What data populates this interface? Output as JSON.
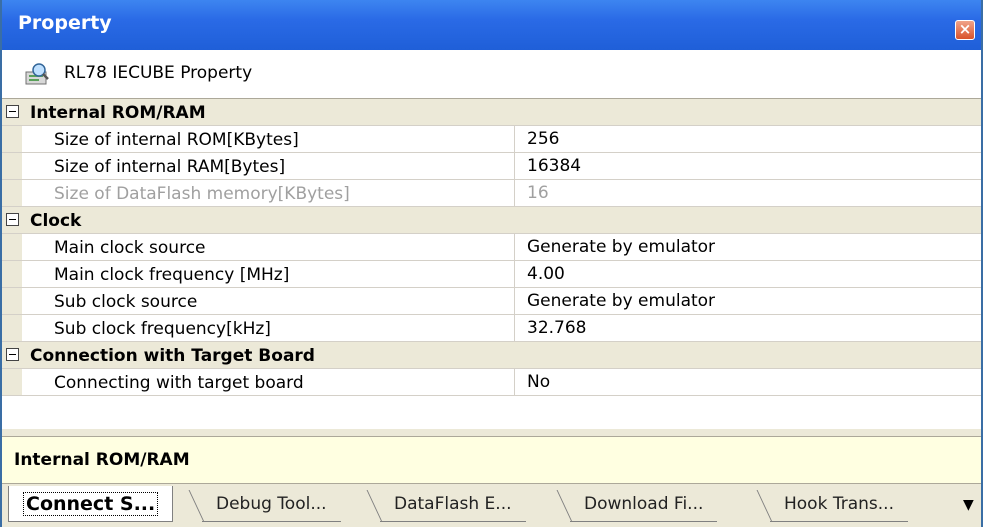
{
  "window": {
    "title": "Property",
    "close_glyph": "×"
  },
  "header": {
    "icon": "property-icon",
    "text": "RL78 IECUBE Property"
  },
  "categories": [
    {
      "name": "Internal ROM/RAM",
      "rows": [
        {
          "name": "Size of internal ROM[KBytes]",
          "value": "256",
          "enabled": true
        },
        {
          "name": "Size of internal RAM[Bytes]",
          "value": "16384",
          "enabled": true
        },
        {
          "name": "Size of DataFlash memory[KBytes]",
          "value": "16",
          "enabled": false
        }
      ]
    },
    {
      "name": "Clock",
      "rows": [
        {
          "name": "Main clock source",
          "value": "Generate by emulator",
          "enabled": true
        },
        {
          "name": "Main clock frequency [MHz]",
          "value": "4.00",
          "enabled": true
        },
        {
          "name": "Sub clock source",
          "value": "Generate by emulator",
          "enabled": true
        },
        {
          "name": "Sub clock frequency[kHz]",
          "value": "32.768",
          "enabled": true
        }
      ]
    },
    {
      "name": "Connection with Target Board",
      "rows": [
        {
          "name": "Connecting with target board",
          "value": "No",
          "enabled": true
        }
      ]
    }
  ],
  "description": {
    "text": "Internal ROM/RAM"
  },
  "tabs": [
    {
      "label": "Connect S...",
      "active": true
    },
    {
      "label": "Debug Tool...",
      "active": false
    },
    {
      "label": "DataFlash E...",
      "active": false
    },
    {
      "label": "Download Fi...",
      "active": false
    },
    {
      "label": "Hook Trans...",
      "active": false
    }
  ],
  "tab_overflow_glyph": "▼",
  "colors": {
    "titlebar": "#2a6ae6",
    "category_bg": "#ece9d8",
    "description_bg": "#ffffe1",
    "disabled_text": "#a0a0a0"
  }
}
